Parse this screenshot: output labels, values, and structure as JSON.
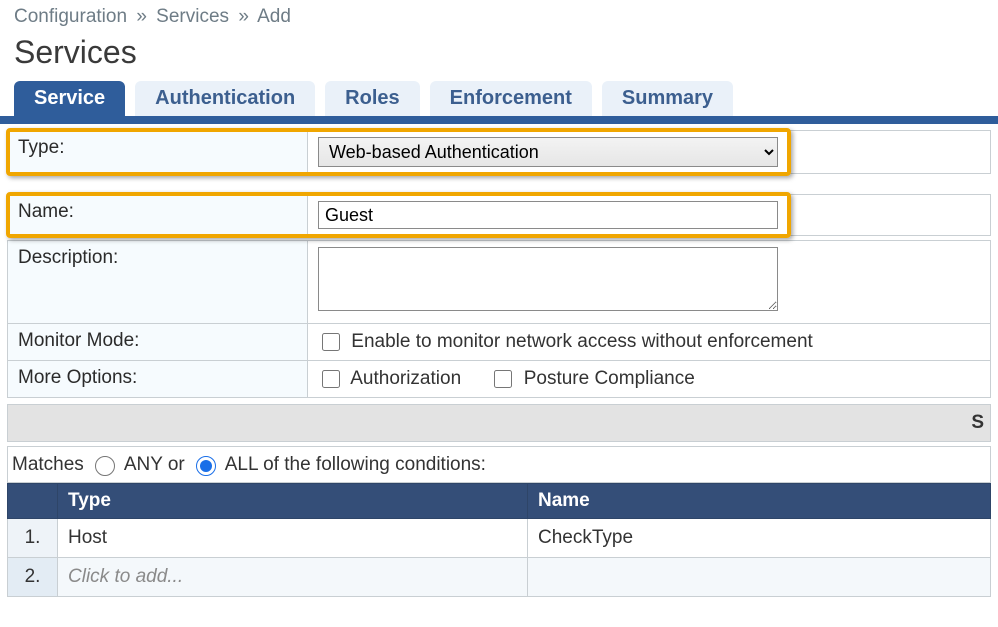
{
  "breadcrumb": {
    "a": "Configuration",
    "b": "Services",
    "c": "Add",
    "sep": "»"
  },
  "page_title": "Services",
  "tabs": {
    "service": "Service",
    "authentication": "Authentication",
    "roles": "Roles",
    "enforcement": "Enforcement",
    "summary": "Summary"
  },
  "form": {
    "type_label": "Type:",
    "type_value": "Web-based Authentication",
    "name_label": "Name:",
    "name_value": "Guest",
    "description_label": "Description:",
    "description_value": "",
    "monitor_mode_label": "Monitor Mode:",
    "monitor_mode_text": "Enable to monitor network access without enforcement",
    "monitor_mode_checked": false,
    "more_options_label": "More Options:",
    "opt_authorization": "Authorization",
    "opt_authorization_checked": false,
    "opt_posture": "Posture Compliance",
    "opt_posture_checked": false
  },
  "gray_bar_hint": "S",
  "matches": {
    "prefix": "Matches",
    "any_label": "ANY or",
    "all_label": "ALL of the following conditions:",
    "selected": "ALL"
  },
  "cond_headers": {
    "num": "",
    "type": "Type",
    "name": "Name"
  },
  "conditions": [
    {
      "num": "1.",
      "type": "Host",
      "name": "CheckType"
    },
    {
      "num": "2.",
      "type_placeholder": "Click to add...",
      "name": ""
    }
  ]
}
